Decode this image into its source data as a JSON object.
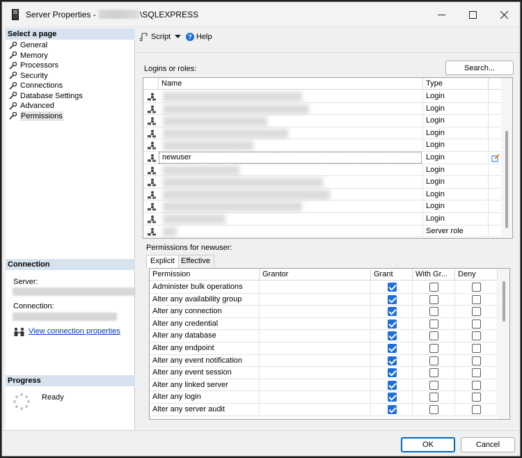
{
  "window": {
    "title_prefix": "Server Properties - ",
    "title_suffix": "\\SQLEXPRESS"
  },
  "left": {
    "select_page_header": "Select a page",
    "pages": [
      "General",
      "Memory",
      "Processors",
      "Security",
      "Connections",
      "Database Settings",
      "Advanced",
      "Permissions"
    ],
    "selected_page": "Permissions",
    "connection_header": "Connection",
    "server_label": "Server:",
    "connection_label": "Connection:",
    "view_connection_link": "View connection properties",
    "progress_header": "Progress",
    "progress_status": "Ready"
  },
  "toolbar": {
    "script_label": "Script",
    "help_label": "Help"
  },
  "logins": {
    "label": "Logins or roles:",
    "search_button": "Search...",
    "columns": [
      "Name",
      "Type"
    ],
    "rows": [
      {
        "name": "",
        "type": "Login"
      },
      {
        "name": "",
        "type": "Login"
      },
      {
        "name": "",
        "type": "Login"
      },
      {
        "name": "",
        "type": "Login"
      },
      {
        "name": "",
        "type": "Login"
      },
      {
        "name": "newuser",
        "type": "Login",
        "selected": true
      },
      {
        "name": "",
        "type": "Login"
      },
      {
        "name": "",
        "type": "Login"
      },
      {
        "name": "",
        "type": "Login"
      },
      {
        "name": "",
        "type": "Login"
      },
      {
        "name": "",
        "type": "Login"
      },
      {
        "name": "",
        "type": "Server role"
      }
    ]
  },
  "permissions": {
    "label": "Permissions for newuser:",
    "tabs": [
      "Explicit",
      "Effective"
    ],
    "active_tab": "Explicit",
    "columns": [
      "Permission",
      "Grantor",
      "Grant",
      "With Gr...",
      "Deny"
    ],
    "rows": [
      {
        "permission": "Administer bulk operations",
        "grantor": "",
        "grant": true,
        "with_grant": false,
        "deny": false
      },
      {
        "permission": "Alter any availability group",
        "grantor": "",
        "grant": true,
        "with_grant": false,
        "deny": false
      },
      {
        "permission": "Alter any connection",
        "grantor": "",
        "grant": true,
        "with_grant": false,
        "deny": false
      },
      {
        "permission": "Alter any credential",
        "grantor": "",
        "grant": true,
        "with_grant": false,
        "deny": false
      },
      {
        "permission": "Alter any database",
        "grantor": "",
        "grant": true,
        "with_grant": false,
        "deny": false
      },
      {
        "permission": "Alter any endpoint",
        "grantor": "",
        "grant": true,
        "with_grant": false,
        "deny": false
      },
      {
        "permission": "Alter any event notification",
        "grantor": "",
        "grant": true,
        "with_grant": false,
        "deny": false
      },
      {
        "permission": "Alter any event session",
        "grantor": "",
        "grant": true,
        "with_grant": false,
        "deny": false
      },
      {
        "permission": "Alter any linked server",
        "grantor": "",
        "grant": true,
        "with_grant": false,
        "deny": false
      },
      {
        "permission": "Alter any login",
        "grantor": "",
        "grant": true,
        "with_grant": false,
        "deny": false
      },
      {
        "permission": "Alter any server audit",
        "grantor": "",
        "grant": true,
        "with_grant": false,
        "deny": false
      }
    ]
  },
  "footer": {
    "ok": "OK",
    "cancel": "Cancel"
  },
  "colors": {
    "accent": "#1e6fd9",
    "section_header": "#d6e3ef",
    "link": "#0033cc"
  }
}
